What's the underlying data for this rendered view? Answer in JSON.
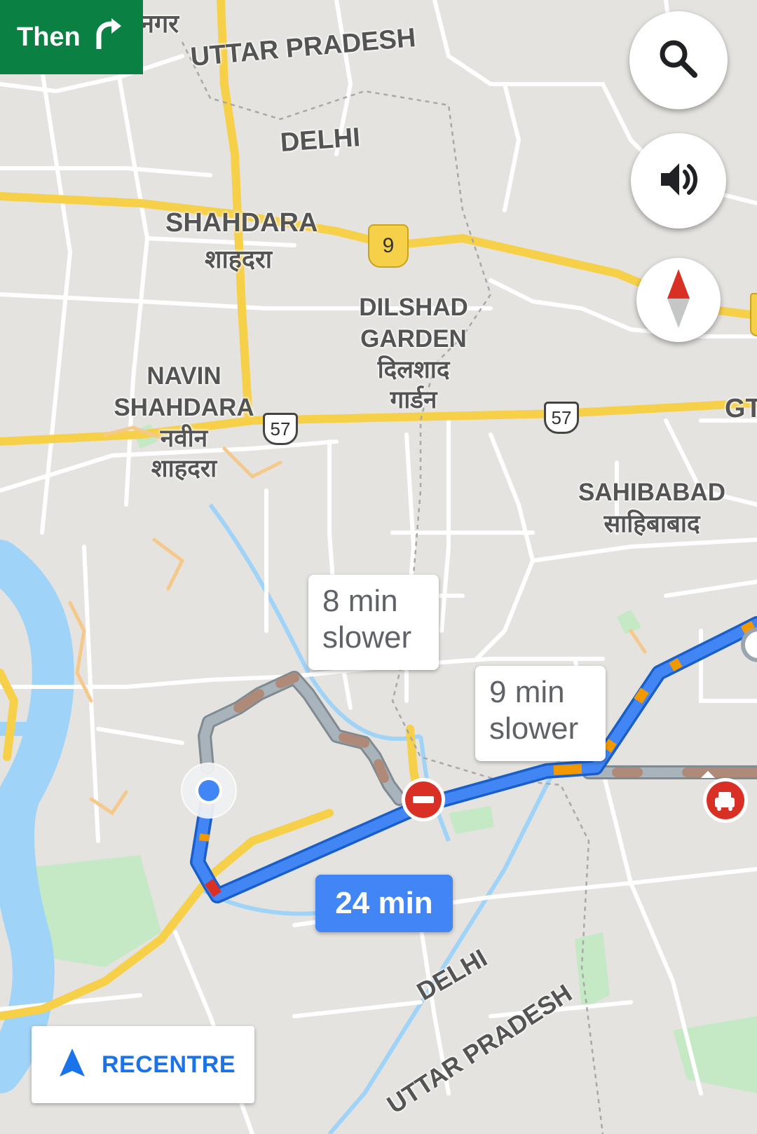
{
  "navigation": {
    "next_turn_label": "Then",
    "next_turn_icon": "turn-right-icon",
    "eta": "24 min",
    "recentre_label": "RECENTRE"
  },
  "alternatives": [
    {
      "line1": "8 min",
      "line2": "slower"
    },
    {
      "line1": "9 min",
      "line2": "slower"
    }
  ],
  "map_labels": {
    "top_partial": "नगर",
    "uttar_pradesh_top": "UTTAR PRADESH",
    "delhi_top": "DELHI",
    "shahdara_en": "SHAHDARA",
    "shahdara_hi": "शाहदरा",
    "dilshad_1": "DILSHAD",
    "dilshad_2": "GARDEN",
    "dilshad_hi_1": "दिलशाद",
    "dilshad_hi_2": "गार्डन",
    "navin_1": "NAVIN",
    "navin_2": "SHAHDARA",
    "navin_hi_1": "नवीन",
    "navin_hi_2": "शाहदरा",
    "sahibabad_en": "SAHIBABAD",
    "sahibabad_hi": "साहिबाबाद",
    "gt_partial": "GT",
    "delhi_bottom": "DELHI",
    "uttar_pradesh_bottom": "UTTAR PRADESH"
  },
  "highway_shields": {
    "state_9": "9",
    "nh_57_left": "57",
    "nh_57_right": "57"
  },
  "controls": {
    "search": "search-icon",
    "volume": "volume-icon",
    "compass": "compass-icon"
  },
  "colors": {
    "route_primary": "#4285f4",
    "route_alternate": "#9aa5ad",
    "traffic_slow": "#f29900",
    "traffic_jam": "#d93025",
    "next_turn_bg": "#0b8043",
    "highway": "#f7d04a",
    "water": "#9fd3f7",
    "park": "#c5e8c5"
  }
}
